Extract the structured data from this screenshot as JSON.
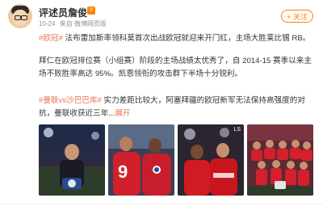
{
  "post": {
    "author": "评述员詹俊",
    "verified_mark": "V",
    "time": "10-24",
    "source": "来自 微博网页版",
    "follow_label": "+ 关注",
    "paragraph1": {
      "tag": "#欧冠#",
      "text": " 法布雷加斯率领科莫首次出战欧冠就迎来开门红，主场大胜莱比锡 RB。"
    },
    "paragraph2": "拜仁在欧冠排位赛（小组赛）阶段的主场战绩太优秀了，自 2014-15 赛季以来主场不败胜率高达 95%。凯恩领衔的攻击群下半场十分锐利。",
    "paragraph3": {
      "tag": "#曼联vs沙巴巴库#",
      "text": " 实力差距比较大，阿塞拜疆的欧冠新军无法保持高强度的对抗，曼联收获近三年",
      "ellipsis": "...",
      "expand_label": "展开"
    }
  },
  "images": {
    "count": 4,
    "photo2_number": "9",
    "photo3_badge": "LS"
  },
  "colors": {
    "brand": "#ff8200",
    "tag": "#eb7350",
    "meta": "#939393"
  }
}
